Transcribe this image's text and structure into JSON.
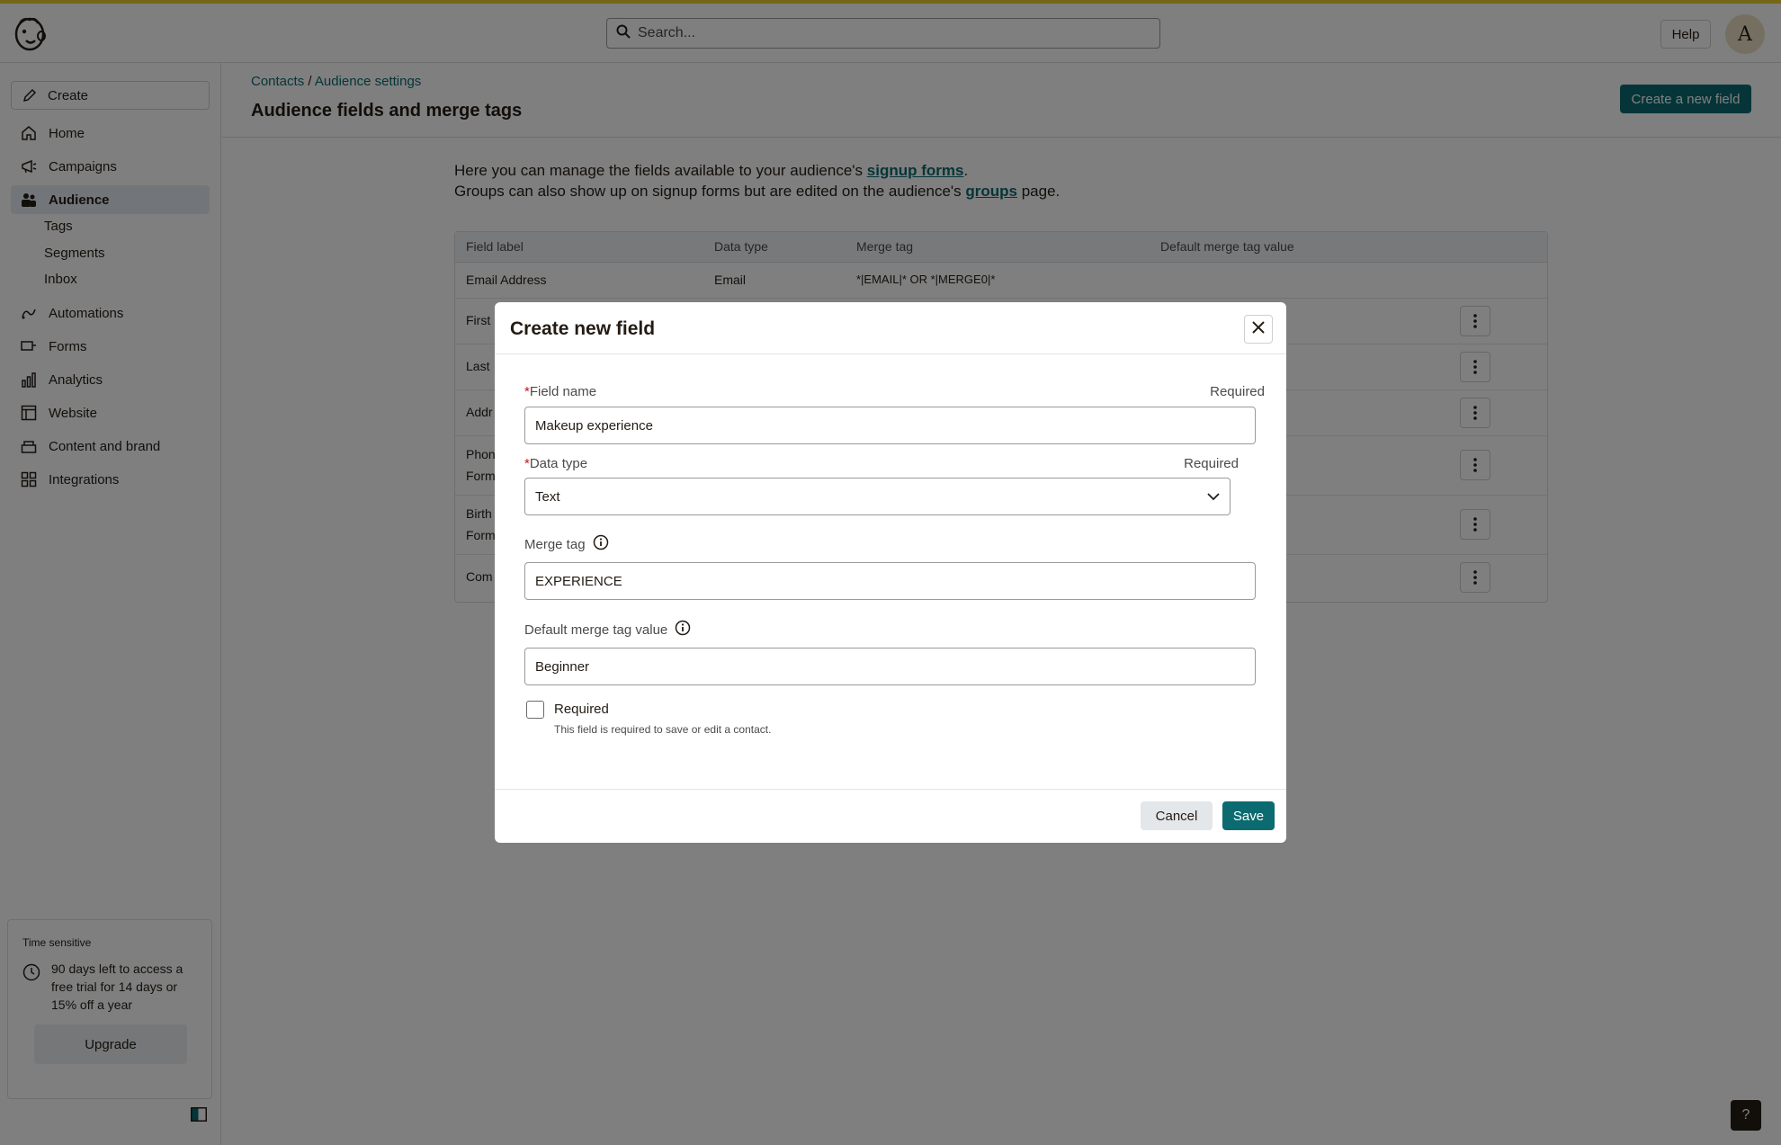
{
  "header": {
    "search_placeholder": "Search...",
    "help_label": "Help",
    "avatar_initial": "A"
  },
  "sidebar": {
    "create_label": "Create",
    "items": [
      {
        "label": "Home",
        "icon": "home-icon"
      },
      {
        "label": "Campaigns",
        "icon": "megaphone-icon"
      },
      {
        "label": "Audience",
        "icon": "audience-icon",
        "active": true
      },
      {
        "label": "Automations",
        "icon": "automations-icon"
      },
      {
        "label": "Forms",
        "icon": "forms-icon"
      },
      {
        "label": "Analytics",
        "icon": "bar-chart-icon"
      },
      {
        "label": "Website",
        "icon": "website-icon"
      },
      {
        "label": "Content and brand",
        "icon": "content-icon"
      },
      {
        "label": "Integrations",
        "icon": "grid-icon"
      }
    ],
    "sub_items": [
      "Tags",
      "Segments",
      "Inbox"
    ],
    "promo": {
      "tag": "Time sensitive",
      "message": "90 days left to access a free trial for 14 days or 15% off a year",
      "upgrade_label": "Upgrade"
    }
  },
  "main": {
    "breadcrumb": {
      "first": "Contacts",
      "separator": "/",
      "second": "Audience settings"
    },
    "title": "Audience fields and merge tags",
    "create_button": "Create a new field",
    "intro": {
      "line1_prefix": "Here you can manage the fields available to your audience's ",
      "line1_link": "signup forms",
      "line1_suffix": ".",
      "line2_prefix": "Groups can also show up on signup forms but are edited on the audience's ",
      "line2_link": "groups",
      "line2_suffix": " page."
    },
    "table": {
      "headers": [
        "Field label",
        "Data type",
        "Merge tag",
        "Default merge tag value"
      ],
      "rows": [
        {
          "label": "Email Address",
          "type": "Email",
          "tag": "*|EMAIL|* OR *|MERGE0|*"
        },
        {
          "label": "First",
          "label2": ""
        },
        {
          "label": "Last",
          "label2": ""
        },
        {
          "label": "Addr",
          "label2": ""
        },
        {
          "label": "Phon",
          "label2": "Form"
        },
        {
          "label": "Birth",
          "label2": "Form"
        },
        {
          "label": "Com",
          "label2": ""
        }
      ]
    }
  },
  "modal": {
    "title": "Create new field",
    "field_name_label": "Field name",
    "field_name_required": "Required",
    "field_name_value": "Makeup experience",
    "data_type_label": "Data type",
    "data_type_required": "Required",
    "data_type_value": "Text",
    "merge_tag_label": "Merge tag",
    "merge_tag_value": "EXPERIENCE",
    "default_value_label": "Default merge tag value",
    "default_value_value": "Beginner",
    "required_checkbox_label": "Required",
    "required_checkbox_help": "This field is required to save or edit a contact.",
    "required_checked": false,
    "cancel_label": "Cancel",
    "save_label": "Save"
  },
  "floating_help_label": "?",
  "colors": {
    "accent": "#0b6b70",
    "top_stripe": "#e6cf30",
    "active_nav_bg": "#e4ebf2"
  }
}
